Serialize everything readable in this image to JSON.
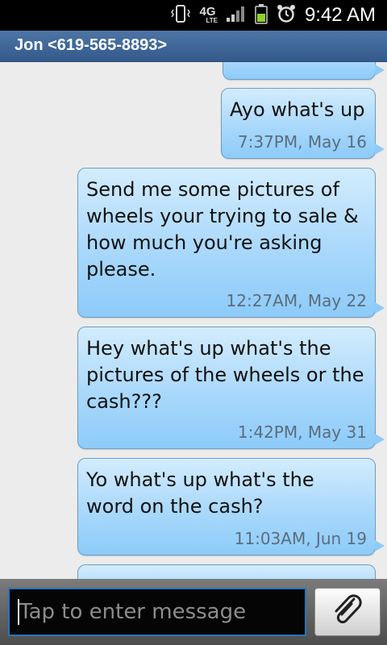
{
  "status_bar": {
    "time": "9:42 AM",
    "network": "4G",
    "network_sub": "LTE",
    "icons": [
      "vibrate-icon",
      "lte-icon",
      "signal-icon",
      "battery-icon",
      "alarm-icon"
    ]
  },
  "header": {
    "contact": "Jon <619-565-8893>"
  },
  "messages": [
    {
      "text": "Ayo what's up",
      "time": "7:37PM, May 16"
    },
    {
      "text": "Send me some pictures of wheels your trying to sale & how much you're asking please.",
      "time": "12:27AM, May 22"
    },
    {
      "text": "Hey what's up what's the pictures of the wheels or the cash???",
      "time": "1:42PM, May 31"
    },
    {
      "text": "Yo what's up what's the word on the cash?",
      "time": "11:03AM, Jun 19"
    }
  ],
  "composer": {
    "placeholder": "Tap to enter message",
    "attach_icon": "paperclip-icon"
  },
  "colors": {
    "bubble": "#a9d8fb",
    "title_bar": "#4d75a6",
    "input_border": "#2c74b5"
  }
}
